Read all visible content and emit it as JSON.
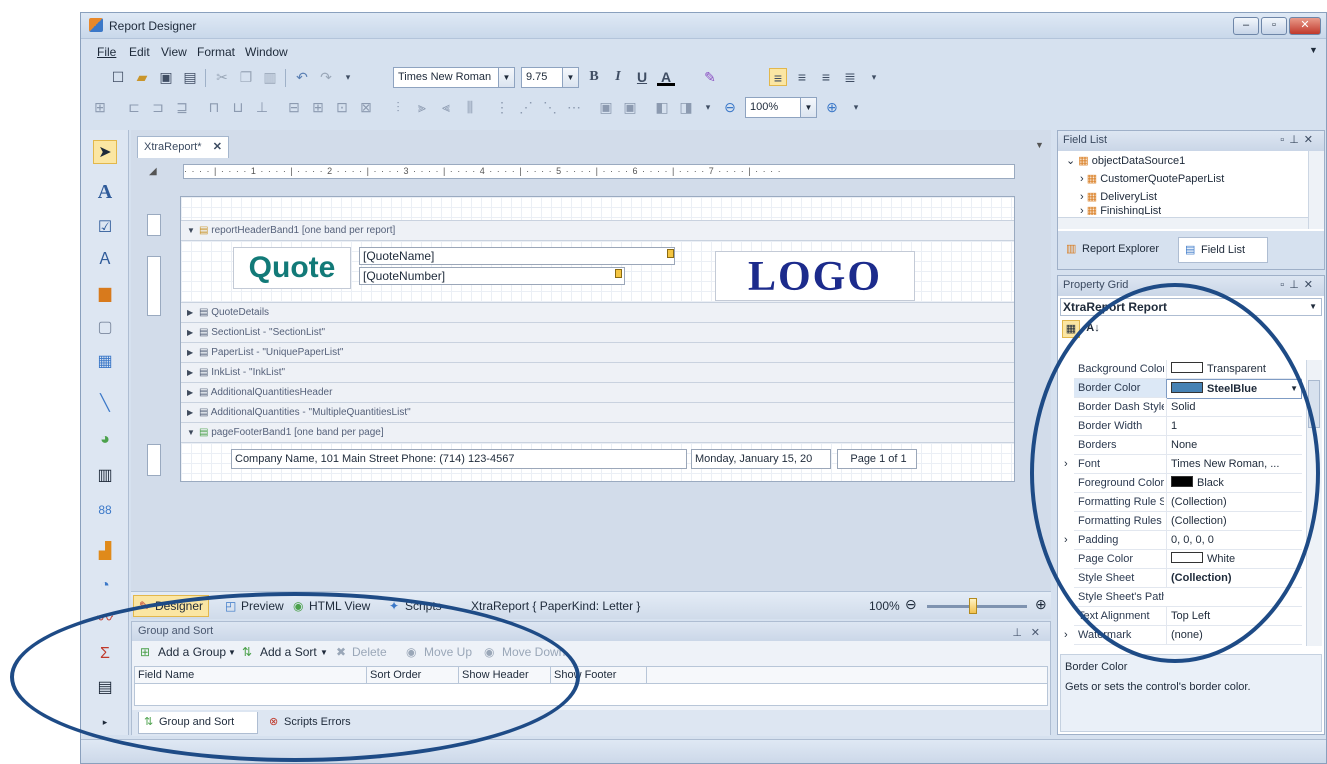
{
  "window": {
    "title": "Report Designer"
  },
  "menu": [
    "File",
    "Edit",
    "View",
    "Format",
    "Window"
  ],
  "format_toolbar": {
    "font_name": "Times New Roman",
    "font_size": "9.75",
    "bold": "B",
    "italic": "I",
    "underline": "U",
    "font_color": "A"
  },
  "layout_toolbar": {
    "zoom": "100%"
  },
  "document": {
    "tab": "XtraReport*",
    "ruler": "· · · · | · · · · 1 · · · · | · · · · 2 · · · · | · · · · 3 · · · · | · · · · 4 · · · · | · · · · 5 · · · · | · · · · 6 · · · · | · · · · 7 · · · · | · · · ·",
    "bands": {
      "header": "reportHeaderBand1 [one band per report]",
      "rows": [
        "QuoteDetails",
        "SectionList - \"SectionList\"",
        "PaperList - \"UniquePaperList\"",
        "InkList - \"InkList\"",
        "AdditionalQuantitiesHeader",
        "AdditionalQuantities - \"MultipleQuantitiesList\""
      ],
      "footer": "pageFooterBand1 [one band per page]"
    },
    "quote_label": "Quote",
    "quote_name": "[QuoteName]",
    "quote_number": "[QuoteNumber]",
    "logo": "LOGO",
    "footer_company": "Company Name,  101 Main Street  Phone: (714) 123-4567",
    "footer_date": "Monday, January 15, 20",
    "footer_page": "Page 1 of 1"
  },
  "statusbar": {
    "designer": "Designer",
    "preview": "Preview",
    "html_view": "HTML View",
    "scripts": "Scripts",
    "report_info": "XtraReport { PaperKind: Letter }",
    "zoom": "100%"
  },
  "group_sort": {
    "title": "Group and Sort",
    "actions": {
      "add_group": "Add a Group",
      "add_sort": "Add a Sort",
      "delete": "Delete",
      "move_up": "Move Up",
      "move_down": "Move Down"
    },
    "columns": [
      "Field Name",
      "Sort Order",
      "Show Header",
      "Show Footer"
    ],
    "tabs": [
      "Group and Sort",
      "Scripts Errors"
    ]
  },
  "field_list": {
    "title": "Field List",
    "root": "objectDataSource1",
    "items": [
      "CustomerQuotePaperList",
      "DeliveryList",
      "FinishingList"
    ],
    "tabs": [
      "Report Explorer",
      "Field List"
    ]
  },
  "property_grid": {
    "title": "Property Grid",
    "object": "XtraReport   Report",
    "rows": [
      {
        "name": "Background Color",
        "value": "Transparent"
      },
      {
        "name": "Border Color",
        "value": "SteelBlue"
      },
      {
        "name": "Border Dash Style",
        "value": "Solid"
      },
      {
        "name": "Border Width",
        "value": "1"
      },
      {
        "name": "Borders",
        "value": "None"
      },
      {
        "name": "Font",
        "value": "Times New Roman, ..."
      },
      {
        "name": "Foreground Color",
        "value": "Black"
      },
      {
        "name": "Formatting Rule Sheet",
        "value": "(Collection)"
      },
      {
        "name": "Formatting Rules",
        "value": "(Collection)"
      },
      {
        "name": "Padding",
        "value": "0, 0, 0, 0"
      },
      {
        "name": "Page Color",
        "value": "White"
      },
      {
        "name": "Style Sheet",
        "value": "(Collection)"
      },
      {
        "name": "Style Sheet's Path",
        "value": ""
      },
      {
        "name": "Text Alignment",
        "value": "Top Left"
      },
      {
        "name": "Watermark",
        "value": "(none)"
      }
    ],
    "desc_title": "Border Color",
    "desc_text": "Gets or sets the control's border color."
  },
  "colors": {
    "accent": "#1e4b86",
    "quote_teal": "#127a78",
    "logo_navy": "#1c2b8c",
    "steelblue": "#4682b4"
  }
}
